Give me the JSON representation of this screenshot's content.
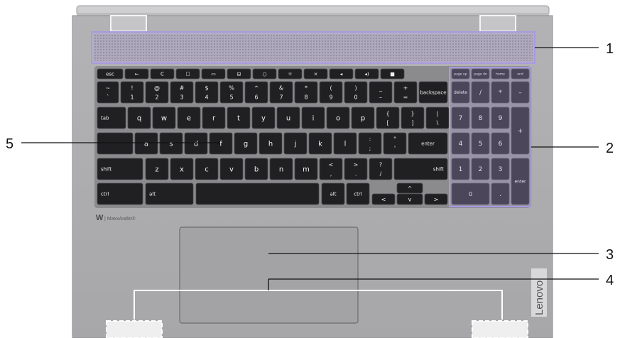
{
  "callouts": [
    {
      "id": "1",
      "label": "1"
    },
    {
      "id": "2",
      "label": "2"
    },
    {
      "id": "3",
      "label": "3"
    },
    {
      "id": "4",
      "label": "4"
    },
    {
      "id": "5",
      "label": "5"
    }
  ],
  "branding": {
    "audio_logo": "| MaxxAudio®",
    "side_logo": "Lenovo"
  },
  "keyboard": {
    "fn_row": [
      "esc",
      "←",
      "C",
      "☐",
      "▭",
      "⊟",
      "○",
      "☼",
      "×",
      "◂",
      "◂)",
      "■",
      "page up",
      "page dn",
      "home",
      "end"
    ],
    "row1": [
      {
        "top": "~",
        "bot": "`"
      },
      {
        "top": "!",
        "bot": "1"
      },
      {
        "top": "@",
        "bot": "2"
      },
      {
        "top": "#",
        "bot": "3"
      },
      {
        "top": "$",
        "bot": "4"
      },
      {
        "top": "%",
        "bot": "5"
      },
      {
        "top": "^",
        "bot": "6"
      },
      {
        "top": "&",
        "bot": "7"
      },
      {
        "top": "*",
        "bot": "8"
      },
      {
        "top": "(",
        "bot": "9"
      },
      {
        "top": ")",
        "bot": "0"
      },
      {
        "top": "_",
        "bot": "–"
      },
      {
        "top": "+",
        "bot": "="
      }
    ],
    "backspace": "backspace",
    "tab": "tab",
    "row2": [
      "q",
      "w",
      "e",
      "r",
      "t",
      "y",
      "u",
      "i",
      "o",
      "p"
    ],
    "row2_extra": [
      {
        "top": "{",
        "bot": "["
      },
      {
        "top": "}",
        "bot": "]"
      },
      {
        "top": "|",
        "bot": "\\"
      }
    ],
    "row3": [
      "a",
      "s",
      "d",
      "f",
      "g",
      "h",
      "j",
      "k",
      "l"
    ],
    "row3_extra": [
      {
        "top": ":",
        "bot": ";"
      },
      {
        "top": "\"",
        "bot": "'"
      }
    ],
    "enter": "enter",
    "shift_left": "shift",
    "row4": [
      "z",
      "x",
      "c",
      "v",
      "b",
      "n",
      "m"
    ],
    "row4_extra": [
      {
        "top": "<",
        "bot": ","
      },
      {
        "top": ">",
        "bot": "."
      },
      {
        "top": "?",
        "bot": "/"
      }
    ],
    "shift_right": "shift",
    "ctrl_left": "ctrl",
    "alt_left": "alt",
    "alt_right": "alt",
    "ctrl_right": "ctrl",
    "arrows": {
      "left": "<",
      "up": "^",
      "down": "v",
      "right": ">"
    },
    "numpad": {
      "row0": [
        "delete",
        "/",
        "*",
        "–"
      ],
      "row1": [
        "7",
        "8",
        "9"
      ],
      "plus": "+",
      "row2": [
        "4",
        "5",
        "6"
      ],
      "row3": [
        "1",
        "2",
        "3"
      ],
      "enter": "enter",
      "zero": "0",
      "dot": "."
    }
  }
}
